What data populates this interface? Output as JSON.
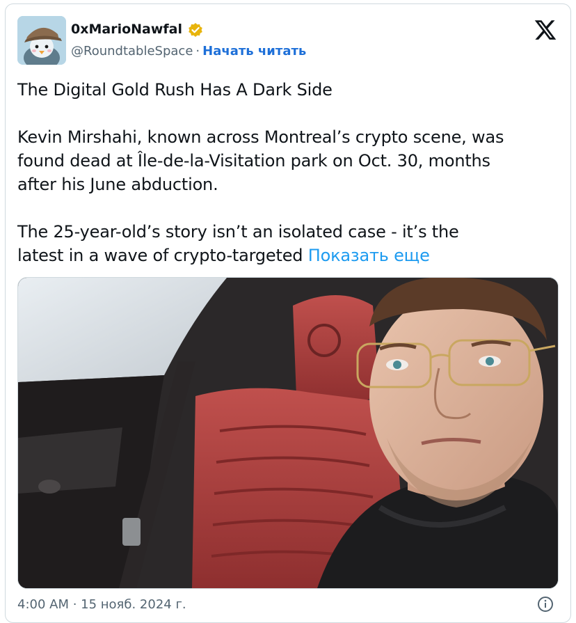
{
  "tweet": {
    "author": {
      "display_name": "0xMarioNawfal",
      "handle": "@RoundtableSpace",
      "separator": "·",
      "follow_label": "Начать читать",
      "verified_color": "#e8b40c"
    },
    "text": {
      "title": "The Digital Gold Rush Has A Dark Side",
      "paragraph_1_lines": [
        "Kevin Mirshahi, known across Montreal’s crypto scene, was",
        "found dead at Île-de-la-Visitation park on Oct. 30, months",
        "after his June abduction."
      ],
      "paragraph_2_lines": [
        "The 25-year-old’s story isn’t an isolated case - it’s the",
        "latest in a wave of crypto-targeted"
      ],
      "show_more_label": "Показать еще"
    },
    "timestamp": "4:00 AM · 15 нояб. 2024 г.",
    "icons": {
      "platform_logo": "x-logo-icon",
      "verified": "verified-badge-icon",
      "info": "info-icon"
    },
    "colors": {
      "accent_link": "#1d9bf0",
      "follow_link": "#1d6fd8",
      "secondary_text": "#536471"
    }
  }
}
